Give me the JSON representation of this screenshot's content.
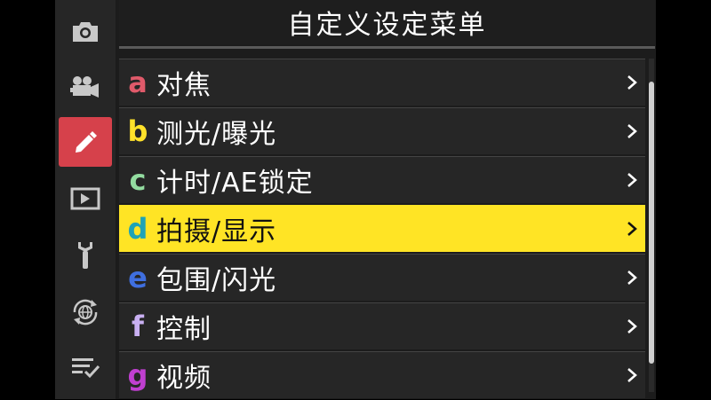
{
  "header": {
    "title": "自定义设定菜单"
  },
  "sidebar": {
    "items": [
      {
        "icon": "camera-icon",
        "active": false
      },
      {
        "icon": "movie-camera-icon",
        "active": false
      },
      {
        "icon": "pencil-icon",
        "active": true
      },
      {
        "icon": "playback-icon",
        "active": false
      },
      {
        "icon": "wrench-icon",
        "active": false
      },
      {
        "icon": "network-globe-icon",
        "active": false
      },
      {
        "icon": "my-menu-icon",
        "active": false
      }
    ]
  },
  "menu": {
    "items": [
      {
        "letter": "a",
        "label": "对焦",
        "color": "#e05a6a"
      },
      {
        "letter": "b",
        "label": "测光/曝光",
        "color": "#ffe12a"
      },
      {
        "letter": "c",
        "label": "计时/AE锁定",
        "color": "#93dca0"
      },
      {
        "letter": "d",
        "label": "拍摄/显示",
        "color": "#1fa3b5"
      },
      {
        "letter": "e",
        "label": "包围/闪光",
        "color": "#3f6fe0"
      },
      {
        "letter": "f",
        "label": "控制",
        "color": "#c9b0f2"
      },
      {
        "letter": "g",
        "label": "视频",
        "color": "#c03fd0"
      }
    ],
    "selected_index": 3
  },
  "colors": {
    "selected_row": "#ffe425",
    "active_tab": "#d6414b",
    "background": "#1c1c1c"
  }
}
